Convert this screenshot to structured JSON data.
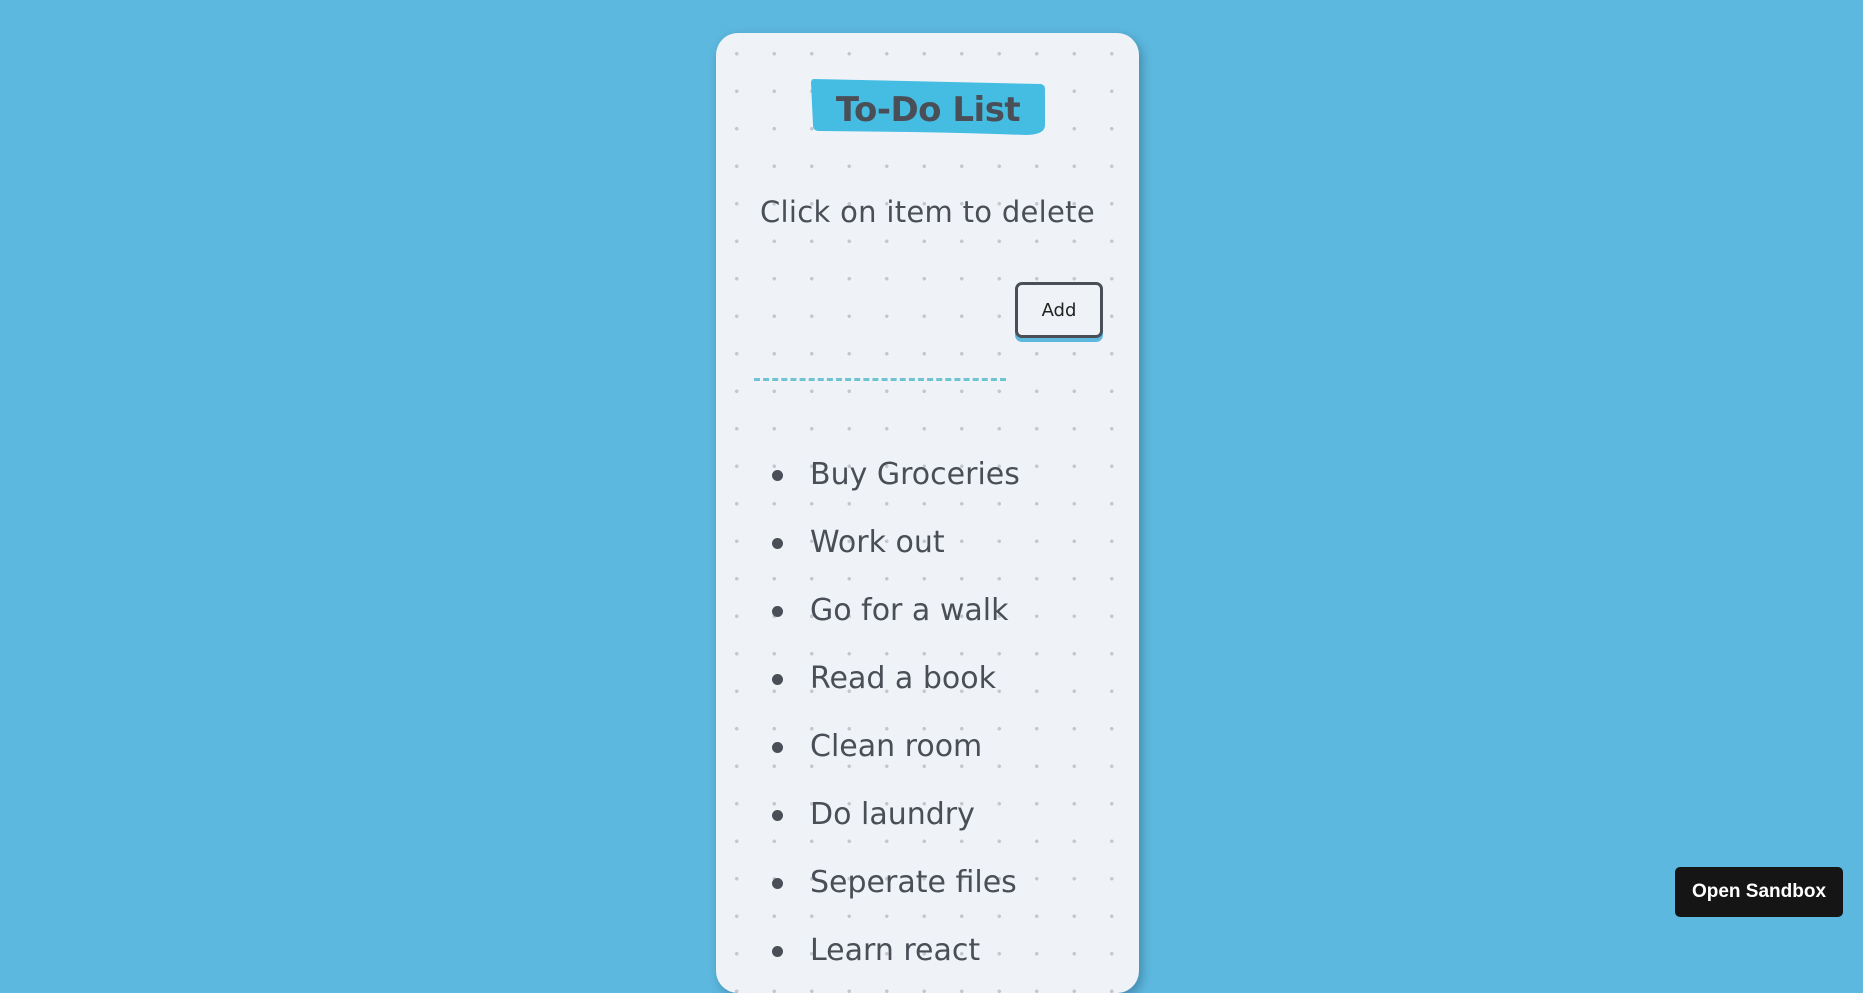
{
  "app": {
    "title": "To-Do List",
    "instruction": "Click on item to delete"
  },
  "form": {
    "input_value": "",
    "add_label": "Add"
  },
  "todos": [
    "Buy Groceries",
    "Work out",
    "Go for a walk",
    "Read a book",
    "Clean room",
    "Do laundry",
    "Seperate files",
    "Learn react"
  ],
  "footer": {
    "open_sandbox_label": "Open Sandbox"
  },
  "colors": {
    "background": "#5db8df",
    "card": "#eff3f7",
    "title_highlight": "#45bde3",
    "text": "#4a4f57",
    "input_underline": "#6fc3d2",
    "sandbox_button": "#151515"
  }
}
